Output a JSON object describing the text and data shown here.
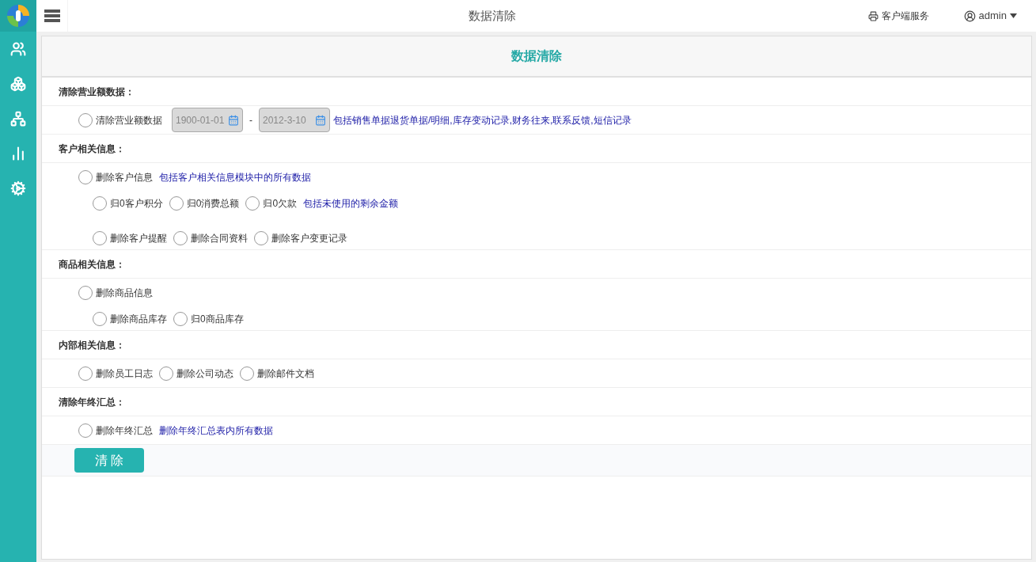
{
  "topbar": {
    "title": "数据清除",
    "service_link": "客户端服务",
    "user": "admin"
  },
  "panel": {
    "title": "数据清除"
  },
  "sections": [
    {
      "title": "清除营业额数据：",
      "rows": [
        {
          "kind": "main",
          "items": [
            {
              "kind": "radio",
              "label": "清除营业额数据",
              "selected": false
            },
            {
              "kind": "date",
              "value": "1900-01-01"
            },
            {
              "kind": "dash",
              "text": "-"
            },
            {
              "kind": "date",
              "value": "2012-3-10"
            },
            {
              "kind": "note",
              "text": "包括销售单据退货单据/明细,库存变动记录,财务往来,联系反馈,短信记录"
            }
          ]
        }
      ]
    },
    {
      "title": "客户相关信息：",
      "rows": [
        {
          "kind": "main",
          "items": [
            {
              "kind": "radio",
              "label": "删除客户信息",
              "selected": false
            },
            {
              "kind": "note",
              "text": "包括客户相关信息模块中的所有数据"
            }
          ]
        },
        {
          "kind": "sub",
          "items": [
            {
              "kind": "radio",
              "label": "归0客户积分",
              "selected": false
            },
            {
              "kind": "radio",
              "label": "归0消费总额",
              "selected": false
            },
            {
              "kind": "radio",
              "label": "归0欠款",
              "selected": false
            },
            {
              "kind": "note",
              "text": "包括未使用的剩余金额"
            }
          ]
        },
        {
          "kind": "sub_spaced",
          "items": [
            {
              "kind": "radio",
              "label": "删除客户提醒",
              "selected": false
            },
            {
              "kind": "radio",
              "label": "删除合同资料",
              "selected": false
            },
            {
              "kind": "radio",
              "label": "删除客户变更记录",
              "selected": false
            }
          ]
        }
      ]
    },
    {
      "title": "商品相关信息：",
      "rows": [
        {
          "kind": "main",
          "items": [
            {
              "kind": "radio",
              "label": "删除商品信息",
              "selected": false
            }
          ]
        },
        {
          "kind": "sub",
          "items": [
            {
              "kind": "radio",
              "label": "删除商品库存",
              "selected": false
            },
            {
              "kind": "radio",
              "label": "归0商品库存",
              "selected": false
            }
          ]
        }
      ]
    },
    {
      "title": "内部相关信息：",
      "rows": [
        {
          "kind": "main",
          "items": [
            {
              "kind": "radio",
              "label": "删除员工日志",
              "selected": false
            },
            {
              "kind": "radio",
              "label": "删除公司动态",
              "selected": false
            },
            {
              "kind": "radio",
              "label": "删除邮件文档",
              "selected": false
            }
          ]
        }
      ]
    },
    {
      "title": "清除年终汇总：",
      "rows": [
        {
          "kind": "main",
          "items": [
            {
              "kind": "radio",
              "label": "删除年终汇总",
              "selected": false
            },
            {
              "kind": "note",
              "text": "删除年终汇总表内所有数据"
            }
          ]
        }
      ]
    }
  ],
  "submit_button": "清 除"
}
